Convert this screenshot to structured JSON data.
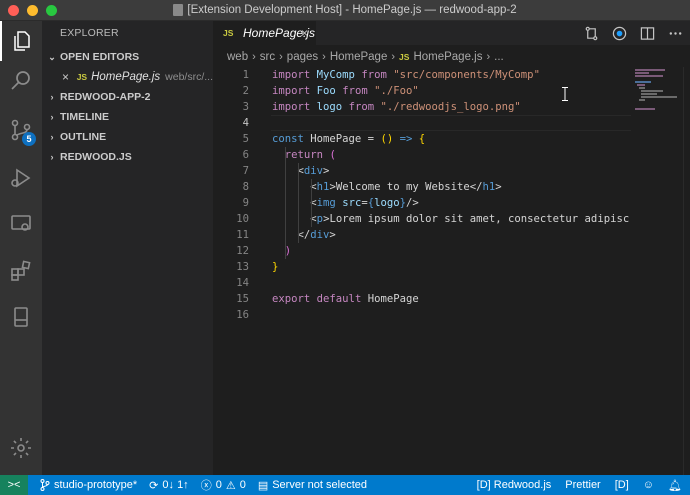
{
  "window": {
    "title": "[Extension Development Host] - HomePage.js — redwood-app-2"
  },
  "activity_bar": {
    "scm_badge": "5"
  },
  "sidebar": {
    "header": "EXPLORER",
    "open_editors_label": "OPEN EDITORS",
    "open_editor": {
      "icon": "JS",
      "name": "HomePage.js",
      "path": "web/src/..."
    },
    "sections": [
      "REDWOOD-APP-2",
      "TIMELINE",
      "OUTLINE",
      "REDWOOD.JS"
    ]
  },
  "tab": {
    "icon": "JS",
    "name": "HomePage.js",
    "close": "×"
  },
  "breadcrumbs": {
    "parts": [
      "web",
      "src",
      "pages",
      "HomePage"
    ],
    "file_icon": "JS",
    "file": "HomePage.js",
    "ellipsis": "..."
  },
  "editor": {
    "line_numbers": [
      "1",
      "2",
      "3",
      "4",
      "5",
      "6",
      "7",
      "8",
      "9",
      "10",
      "11",
      "12",
      "13",
      "14",
      "15",
      "16"
    ],
    "current_line": "4",
    "lines": [
      [
        [
          "kw",
          "import"
        ],
        [
          "plain",
          " "
        ],
        [
          "var",
          "MyComp"
        ],
        [
          "plain",
          " "
        ],
        [
          "kw",
          "from"
        ],
        [
          "plain",
          " "
        ],
        [
          "str",
          "\"src/components/MyComp\""
        ]
      ],
      [
        [
          "kw",
          "import"
        ],
        [
          "plain",
          " "
        ],
        [
          "var",
          "Foo"
        ],
        [
          "plain",
          " "
        ],
        [
          "kw",
          "from"
        ],
        [
          "plain",
          " "
        ],
        [
          "str",
          "\"./Foo\""
        ]
      ],
      [
        [
          "kw",
          "import"
        ],
        [
          "plain",
          " "
        ],
        [
          "var",
          "logo"
        ],
        [
          "plain",
          " "
        ],
        [
          "kw",
          "from"
        ],
        [
          "plain",
          " "
        ],
        [
          "str",
          "\"./redwoodjs_logo.png\""
        ]
      ],
      [],
      [
        [
          "kwb",
          "const"
        ],
        [
          "plain",
          " HomePage = "
        ],
        [
          "br",
          "()"
        ],
        [
          "plain",
          " "
        ],
        [
          "kwb",
          "=>"
        ],
        [
          "plain",
          " "
        ],
        [
          "br",
          "{"
        ]
      ],
      [
        [
          "plain",
          "  "
        ],
        [
          "kw",
          "return"
        ],
        [
          "plain",
          " "
        ],
        [
          "br2",
          "("
        ]
      ],
      [
        [
          "plain",
          "    "
        ],
        [
          "plain",
          "<"
        ],
        [
          "tag",
          "div"
        ],
        [
          "plain",
          ">"
        ]
      ],
      [
        [
          "plain",
          "      "
        ],
        [
          "plain",
          "<"
        ],
        [
          "tag",
          "h1"
        ],
        [
          "plain",
          ">Welcome to my Website</"
        ],
        [
          "tag",
          "h1"
        ],
        [
          "plain",
          ">"
        ]
      ],
      [
        [
          "plain",
          "      "
        ],
        [
          "plain",
          "<"
        ],
        [
          "tag",
          "img"
        ],
        [
          "plain",
          " "
        ],
        [
          "var",
          "src"
        ],
        [
          "plain",
          "="
        ],
        [
          "kwb",
          "{"
        ],
        [
          "var",
          "logo"
        ],
        [
          "kwb",
          "}"
        ],
        [
          "plain",
          "/>"
        ]
      ],
      [
        [
          "plain",
          "      "
        ],
        [
          "plain",
          "<"
        ],
        [
          "tag",
          "p"
        ],
        [
          "plain",
          ">Lorem ipsum dolor sit amet, consectetur adipisc"
        ]
      ],
      [
        [
          "plain",
          "    "
        ],
        [
          "plain",
          "</"
        ],
        [
          "tag",
          "div"
        ],
        [
          "plain",
          ">"
        ]
      ],
      [
        [
          "plain",
          "  "
        ],
        [
          "br2",
          ")"
        ]
      ],
      [
        [
          "br",
          "}"
        ]
      ],
      [],
      [
        [
          "kw",
          "export"
        ],
        [
          "plain",
          " "
        ],
        [
          "kw",
          "default"
        ],
        [
          "plain",
          " HomePage"
        ]
      ],
      []
    ]
  },
  "statusbar": {
    "remote_icon": "><",
    "branch": "studio-prototype*",
    "sync": "0↓ 1↑",
    "errors": "0",
    "warnings": "0",
    "server": "Server not selected",
    "framework": "[D] Redwood.js",
    "formatter": "Prettier",
    "d_badge": "[D]"
  }
}
